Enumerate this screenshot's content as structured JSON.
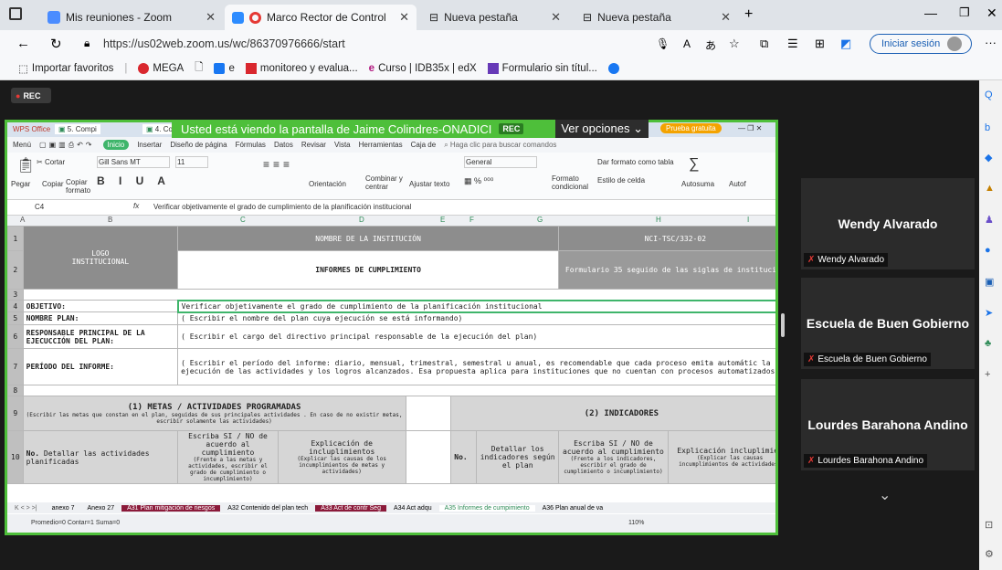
{
  "browser": {
    "tabs": [
      {
        "label": "Mis reuniones - Zoom"
      },
      {
        "label": "Marco Rector de Control Int"
      },
      {
        "label": "Nueva pestaña"
      },
      {
        "label": "Nueva pestaña"
      }
    ],
    "url": "https://us02web.zoom.us/wc/86370976666/start",
    "signin": "Iniciar sesión",
    "favorites": [
      "Importar favoritos",
      "MEGA",
      "e",
      "monitoreo y evalua...",
      "Curso | IDB35x | edX",
      "Formulario sin títul..."
    ]
  },
  "zoom": {
    "rec": "REC",
    "banner": "Usted está viendo la pantalla de Jaime Colindres-ONADICI",
    "banner_rec": "REC",
    "options": "Ver opciones",
    "participants": [
      {
        "name": "Wendy Alvarado",
        "tag": "Wendy Alvarado"
      },
      {
        "name": "Escuela de Buen Gobierno",
        "tag": "Escuela de Buen Gobierno"
      },
      {
        "name": "Lourdes Barahona Andino",
        "tag": "Lourdes Barahona Andino"
      }
    ]
  },
  "wps": {
    "app": "WPS Office",
    "tabs": [
      "5. Compi",
      "4. Co"
    ],
    "trial": "Prueba gratuita",
    "menu": [
      "Menú",
      "Inicio",
      "Insertar",
      "Diseño de página",
      "Fórmulas",
      "Datos",
      "Revisar",
      "Vista",
      "Herramientas",
      "Caja de"
    ],
    "search": "Haga clic para buscar comandos",
    "ribbon": {
      "cut": "Cortar",
      "paste": "Pegar",
      "copy": "Copiar",
      "format": "Copiar formato",
      "font": "Gill Sans MT",
      "size": "11",
      "orient": "Orientación",
      "merge": "Combinar y centrar",
      "wrap": "Ajustar texto",
      "numfmt": "General",
      "cond": "Formato condicional",
      "table": "Dar formato como tabla",
      "style": "Estilo de celda",
      "autosum": "Autosuma",
      "autof": "Autof"
    },
    "cellref": "C4",
    "formula": "Verificar objetivamente el grado de cumplimiento de la planificación institucional",
    "cols": [
      "A",
      "B",
      "C",
      "D",
      "E",
      "F",
      "G",
      "H",
      "I"
    ],
    "rows": [
      "1",
      "2",
      "3",
      "4",
      "5",
      "6",
      "7",
      "8",
      "9",
      "10"
    ],
    "cells": {
      "logo": "LOGO\nINSTITUCIONAL",
      "inst": "NOMBRE DE LA INSTITUCIÓN",
      "code": "NCI-TSC/332-02",
      "informes": "INFORMES DE CUMPLIMIENTO",
      "formulario": "Formulario 35 seguido de las siglas de institución",
      "objetivo_l": "OBJETIVO:",
      "objetivo_v": "Verificar objetivamente el grado de cumplimiento de la planificación institucional",
      "plan_l": "NOMBRE PLAN:",
      "plan_v": "( Escribir el nombre del plan cuya ejecución se está informando)",
      "resp_l": "RESPONSABLE PRINCIPAL DE LA EJECUCCIÓN DEL PLAN:",
      "resp_v": "( Escribir el cargo del directivo principal responsable de la ejecución del plan)",
      "periodo_l": "PERÍODO DEL INFORME:",
      "periodo_v": "( Escribir el período del informe: diario, mensual, trimestral, semestral u anual, es recomendable que cada proceso emita automátic la ejecución de las actividades y los logros alcanzados. Esa propuesta aplica para instituciones que no cuentan con procesos automatizados)",
      "metas": "(1) METAS / ACTIVIDADES PROGRAMADAS",
      "metas_sub": "(Escribir las metas que constan en el plan, seguidas de sus principales actividades . En caso de no existir metas, escribir solamente las actividades)",
      "indicadores": "(2) INDICADORES",
      "no": "No.",
      "detallar": "Detallar las actividades planificadas",
      "escriba": "Escriba SI / NO de acuerdo al cumplimiento",
      "escriba_sub": "(Frente a las metas y actividades, escribir el grado de cumplimiento o incumplimiento)",
      "explic": "Explicación de incluplimientos",
      "explic_sub": "(Explicar las causas de los incumplimientos de metas y actividades)",
      "no2": "No.",
      "detallar_ind": "Detallar los indicadores según el plan",
      "escriba2": "Escriba SI / NO de acuerdo al cumplimiento",
      "escriba2_sub": "(Frente a los indicadores, escribir el grado de cumplimiento o incumplimiento)",
      "explic2": "Explicación incluplimien",
      "explic2_sub": "(Explicar las causas incumplimientos de actividades)"
    },
    "sheets": [
      "anexo 7",
      "Anexo 27",
      "A31 Plan mitigación de riesgos",
      "A32 Contenido del plan tech",
      "A33 Act de contr Seg",
      "A34 Act adqu",
      "A35 Informes de cumpimiento",
      "A36 Plan anual de va"
    ],
    "status": "Promedio=0  Contar=1  Suma=0",
    "zoom": "110%"
  }
}
